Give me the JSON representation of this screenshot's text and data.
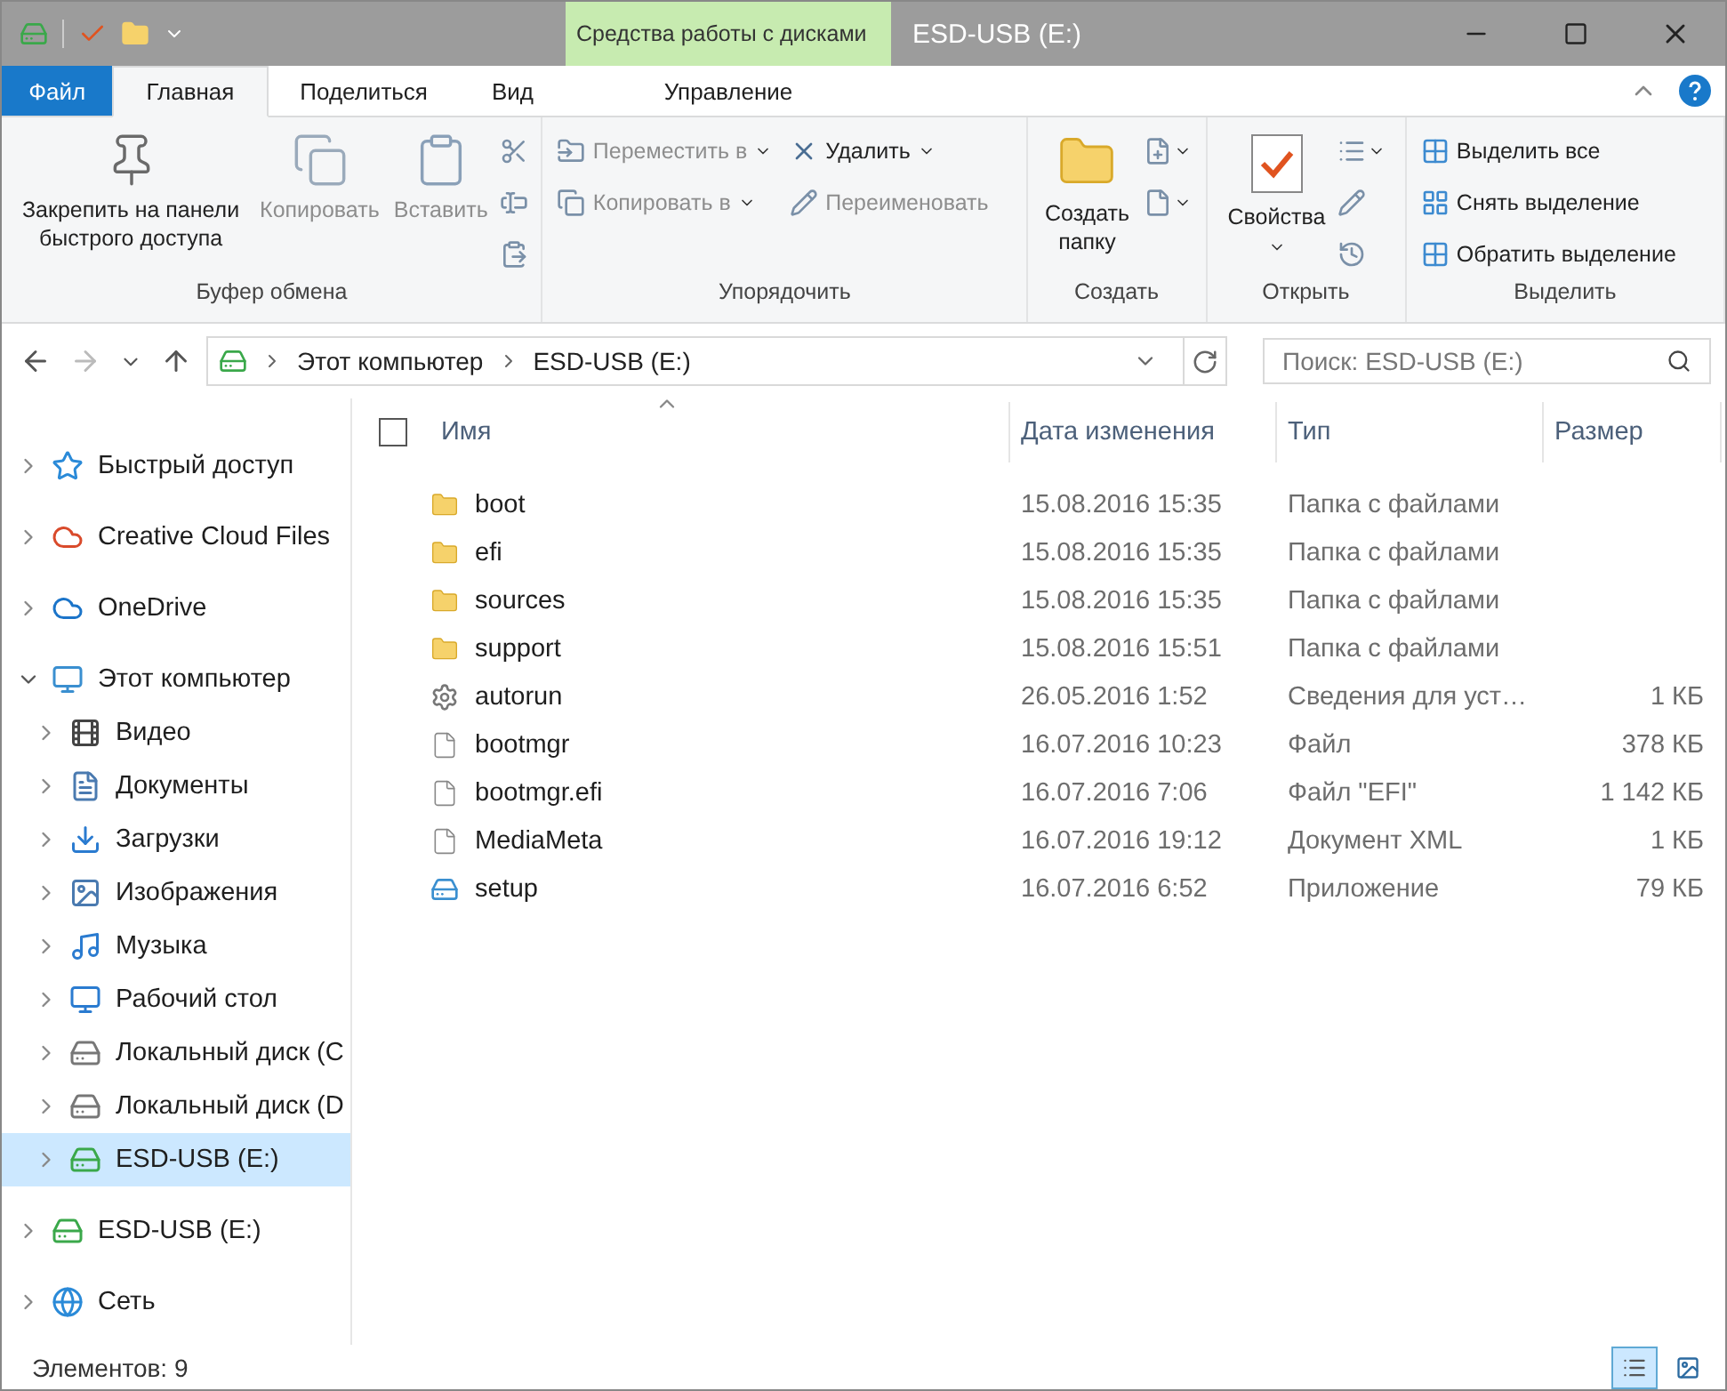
{
  "title_bar": {
    "context_tab": "Средства работы с дисками",
    "title": "ESD-USB (E:)"
  },
  "ribbon_tabs": [
    {
      "label": "Файл",
      "kind": "file",
      "selected": false
    },
    {
      "label": "Главная",
      "kind": "normal",
      "selected": true
    },
    {
      "label": "Поделиться",
      "kind": "normal",
      "selected": false
    },
    {
      "label": "Вид",
      "kind": "normal",
      "selected": false
    },
    {
      "label": "Управление",
      "kind": "context",
      "selected": false
    }
  ],
  "ribbon_groups": [
    {
      "label": "Буфер обмена",
      "items": [
        {
          "kind": "large",
          "label": "Закрепить на панели быстрого доступа",
          "disabled": false,
          "menu": false
        },
        {
          "kind": "large",
          "label": "Копировать",
          "disabled": true,
          "menu": false
        },
        {
          "kind": "large",
          "label": "Вставить",
          "disabled": true,
          "menu": false
        },
        {
          "kind": "icon",
          "menu": false
        },
        {
          "kind": "icon",
          "menu": false
        },
        {
          "kind": "icon",
          "menu": false
        }
      ]
    },
    {
      "label": "Упорядочить",
      "items": [
        {
          "kind": "small",
          "label": "Переместить в",
          "disabled": true,
          "menu": true
        },
        {
          "kind": "small",
          "label": "Копировать в",
          "disabled": true,
          "menu": true
        },
        {
          "kind": "small",
          "label": "Удалить",
          "disabled": false,
          "menu": true
        },
        {
          "kind": "small",
          "label": "Переименовать",
          "disabled": true,
          "menu": false
        }
      ]
    },
    {
      "label": "Создать",
      "items": [
        {
          "kind": "large",
          "label": "Создать папку",
          "disabled": false,
          "menu": false
        },
        {
          "kind": "icon",
          "menu": true
        },
        {
          "kind": "icon",
          "menu": true
        }
      ]
    },
    {
      "label": "Открыть",
      "items": [
        {
          "kind": "large",
          "label": "Свойства",
          "disabled": false,
          "menu": true
        },
        {
          "kind": "icon",
          "menu": true
        },
        {
          "kind": "icon",
          "menu": false
        },
        {
          "kind": "icon",
          "menu": false
        }
      ]
    },
    {
      "label": "Выделить",
      "items": [
        {
          "kind": "small",
          "label": "Выделить все",
          "disabled": false,
          "menu": false
        },
        {
          "kind": "small",
          "label": "Снять выделение",
          "disabled": false,
          "menu": false
        },
        {
          "kind": "small",
          "label": "Обратить выделение",
          "disabled": false,
          "menu": false
        }
      ]
    }
  ],
  "address_bar": {
    "path": [
      "Этот компьютер",
      "ESD-USB (E:)"
    ]
  },
  "search": {
    "placeholder": "Поиск: ESD-USB (E:)"
  },
  "navigation": [
    {
      "label": "Быстрый доступ",
      "kind": "star",
      "expanded": false,
      "selected": false
    },
    {
      "label": "Creative Cloud Files",
      "kind": "cloudfolder",
      "expanded": false,
      "selected": false
    },
    {
      "label": "OneDrive",
      "kind": "onedrive",
      "expanded": false,
      "selected": false
    },
    {
      "label": "Этот компьютер",
      "kind": "computer",
      "expanded": true,
      "selected": false,
      "children": [
        {
          "label": "Видео",
          "kind": "video",
          "expanded": false,
          "selected": false
        },
        {
          "label": "Документы",
          "kind": "documents",
          "expanded": false,
          "selected": false
        },
        {
          "label": "Загрузки",
          "kind": "downloads",
          "expanded": false,
          "selected": false
        },
        {
          "label": "Изображения",
          "kind": "pictures",
          "expanded": false,
          "selected": false
        },
        {
          "label": "Музыка",
          "kind": "music",
          "expanded": false,
          "selected": false
        },
        {
          "label": "Рабочий стол",
          "kind": "desktop",
          "expanded": false,
          "selected": false
        },
        {
          "label": "Локальный диск (C",
          "kind": "windisk",
          "expanded": false,
          "selected": false
        },
        {
          "label": "Локальный диск (D",
          "kind": "disk",
          "expanded": false,
          "selected": false
        },
        {
          "label": "ESD-USB (E:)",
          "kind": "usb",
          "expanded": false,
          "selected": true
        }
      ]
    },
    {
      "label": "ESD-USB (E:)",
      "kind": "usb",
      "expanded": false,
      "selected": false
    },
    {
      "label": "Сеть",
      "kind": "network",
      "expanded": false,
      "selected": false
    }
  ],
  "file_list": {
    "select_all": {
      "checked": false
    },
    "columns": [
      "Имя",
      "Дата изменения",
      "Тип",
      "Размер"
    ],
    "rows": [
      {
        "name": "boot",
        "kind": "folder",
        "date": "15.08.2016 15:35",
        "type": "Папка с файлами"
      },
      {
        "name": "efi",
        "kind": "folder",
        "date": "15.08.2016 15:35",
        "type": "Папка с файлами"
      },
      {
        "name": "sources",
        "kind": "folder",
        "date": "15.08.2016 15:35",
        "type": "Папка с файлами"
      },
      {
        "name": "support",
        "kind": "folder",
        "date": "15.08.2016 15:51",
        "type": "Папка с файлами"
      },
      {
        "name": "autorun",
        "kind": "settings",
        "date": "26.05.2016 1:52",
        "type": "Сведения для уст…",
        "size": "1 КБ"
      },
      {
        "name": "bootmgr",
        "kind": "file",
        "date": "16.07.2016 10:23",
        "type": "Файл",
        "size": "378 КБ"
      },
      {
        "name": "bootmgr.efi",
        "kind": "file",
        "date": "16.07.2016 7:06",
        "type": "Файл \"EFI\"",
        "size": "1 142 КБ"
      },
      {
        "name": "MediaMeta",
        "kind": "file",
        "date": "16.07.2016 19:12",
        "type": "Документ XML",
        "size": "1 КБ"
      },
      {
        "name": "setup",
        "kind": "app",
        "date": "16.07.2016 6:52",
        "type": "Приложение",
        "size": "79 КБ"
      }
    ]
  },
  "status_bar": {
    "count": "Элементов: 9",
    "views": [
      {
        "kind": "details",
        "selected": true
      },
      {
        "kind": "thumbnails",
        "selected": false
      }
    ]
  }
}
